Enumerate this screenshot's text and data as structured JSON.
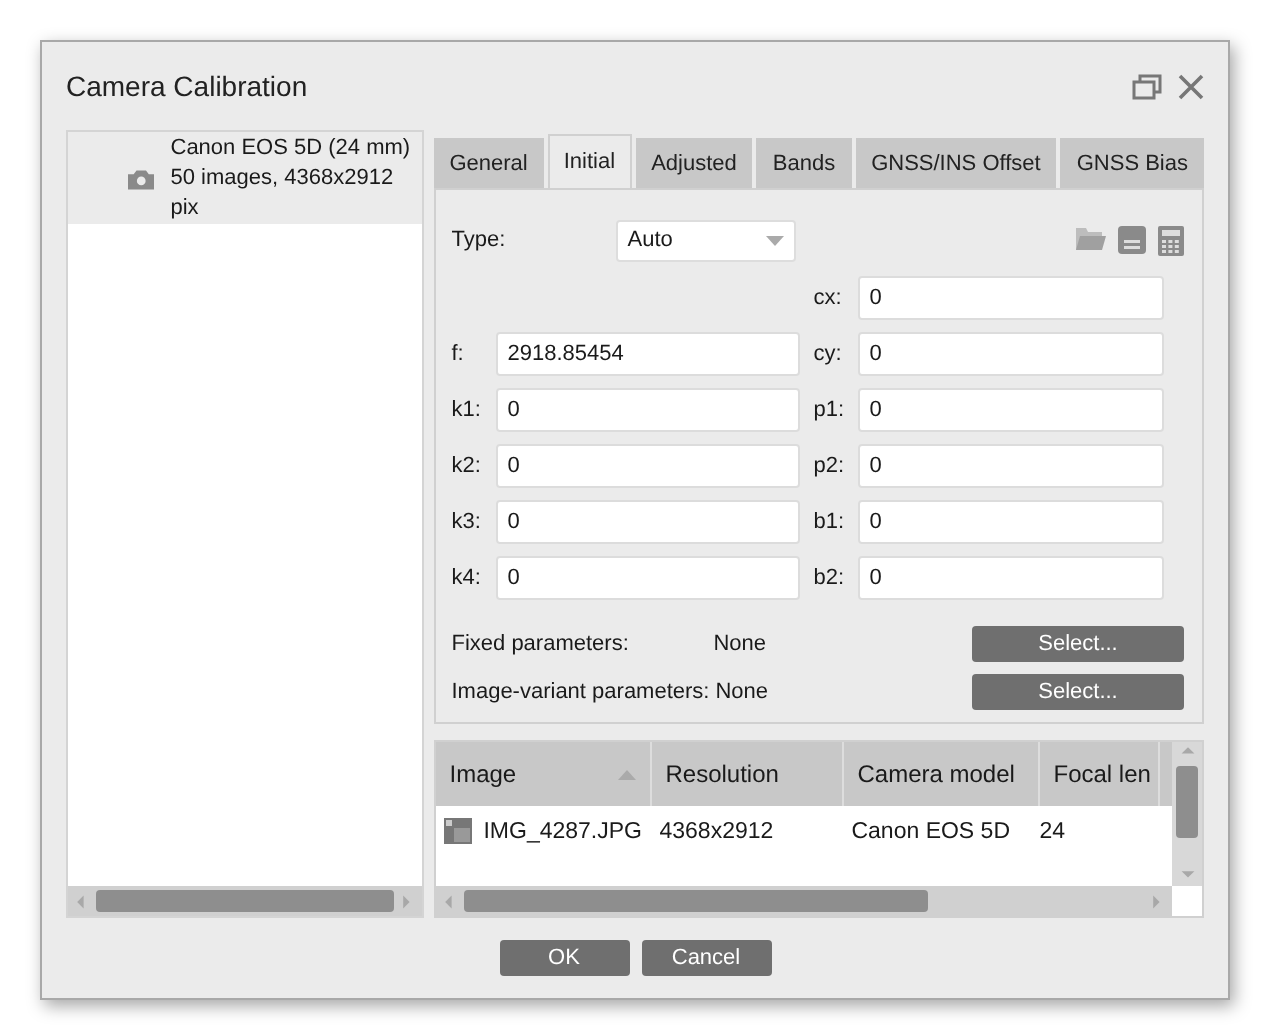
{
  "window": {
    "title": "Camera Calibration"
  },
  "cameras": [
    {
      "name": "Canon EOS 5D (24 mm)",
      "details": "50 images, 4368x2912 pix",
      "selected": true
    }
  ],
  "tabs": [
    {
      "label": "General",
      "selected": false
    },
    {
      "label": "Initial",
      "selected": true
    },
    {
      "label": "Adjusted",
      "selected": false
    },
    {
      "label": "Bands",
      "selected": false
    },
    {
      "label": "GNSS/INS Offset",
      "selected": false
    },
    {
      "label": "GNSS Bias",
      "selected": false
    }
  ],
  "type": {
    "label": "Type:",
    "value": "Auto"
  },
  "rows": [
    {
      "right": {
        "label": "cx:",
        "value": "0"
      }
    },
    {
      "left": {
        "label": "f:",
        "value": "2918.85454"
      },
      "right": {
        "label": "cy:",
        "value": "0"
      }
    },
    {
      "left": {
        "label": "k1:",
        "value": "0"
      },
      "right": {
        "label": "p1:",
        "value": "0"
      }
    },
    {
      "left": {
        "label": "k2:",
        "value": "0"
      },
      "right": {
        "label": "p2:",
        "value": "0"
      }
    },
    {
      "left": {
        "label": "k3:",
        "value": "0"
      },
      "right": {
        "label": "b1:",
        "value": "0"
      }
    },
    {
      "left": {
        "label": "k4:",
        "value": "0"
      },
      "right": {
        "label": "b2:",
        "value": "0"
      }
    }
  ],
  "options": [
    {
      "label": "Fixed parameters:",
      "value": "None",
      "button": "Select..."
    },
    {
      "label": "Image-variant parameters:",
      "value": "None",
      "button": "Select..."
    }
  ],
  "table": {
    "columns": [
      {
        "label": "Image",
        "sorted": true
      },
      {
        "label": "Resolution",
        "sorted": false
      },
      {
        "label": "Camera model",
        "sorted": false
      },
      {
        "label": "Focal len",
        "sorted": false
      }
    ],
    "rows": [
      [
        "IMG_4287.JPG",
        "4368x2912",
        "Canon EOS 5D",
        "24"
      ]
    ]
  },
  "buttons": [
    "OK",
    "Cancel"
  ]
}
